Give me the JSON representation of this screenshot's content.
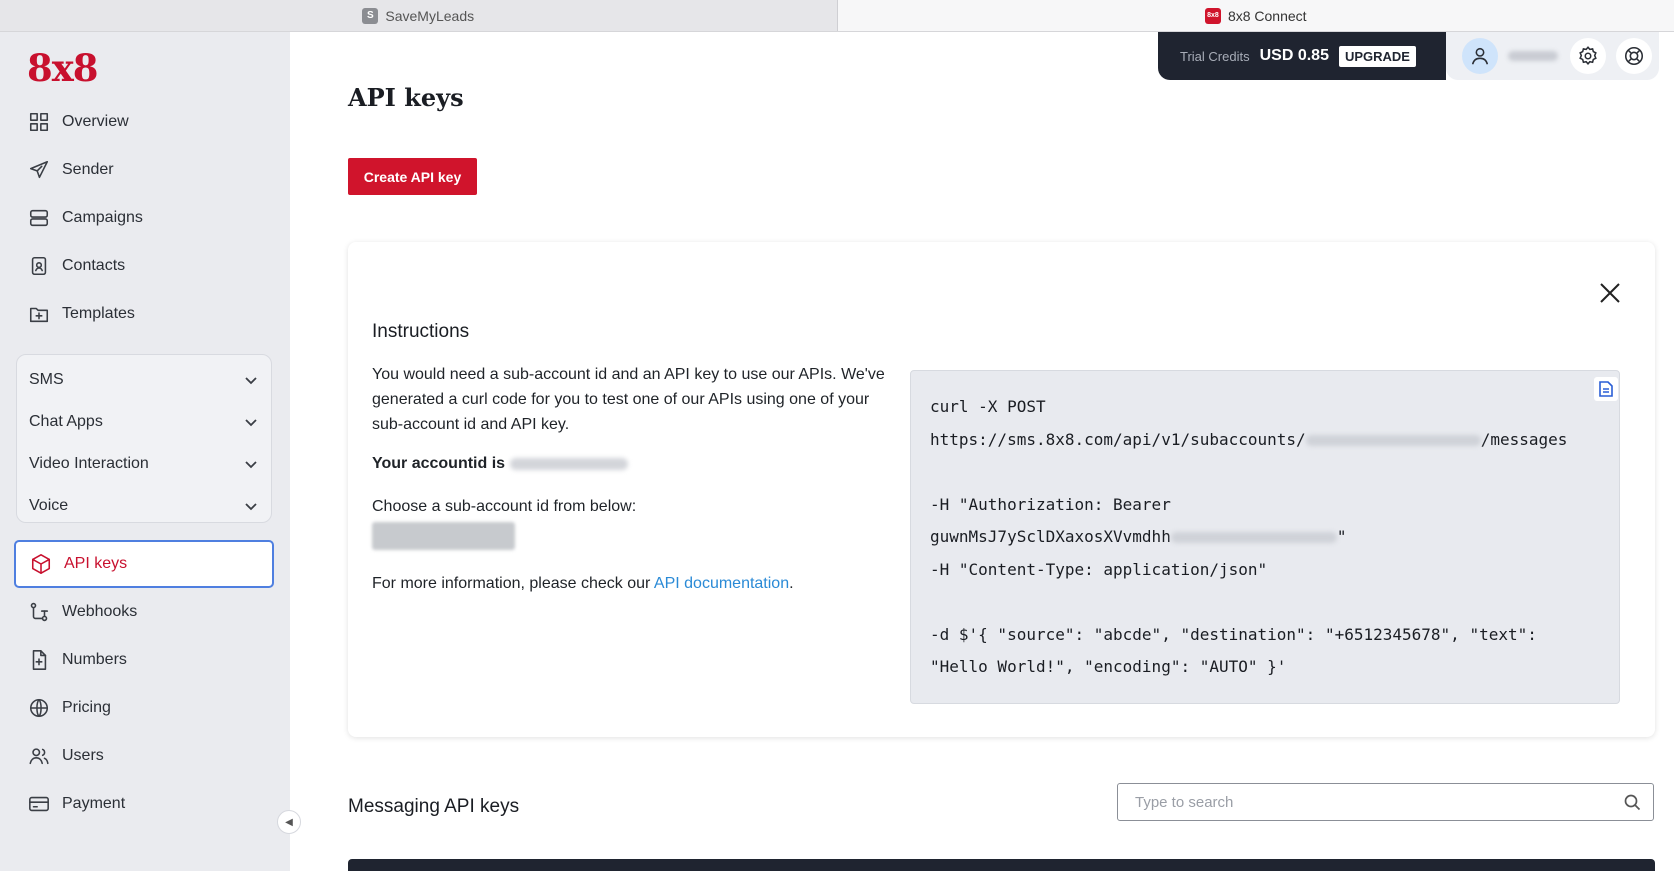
{
  "browser_tabs": [
    {
      "favicon": "S",
      "label": "SaveMyLeads"
    },
    {
      "favicon": "8x8",
      "label": "8x8 Connect"
    }
  ],
  "sidebar": {
    "logo": "8x8",
    "top_items": [
      {
        "label": "Overview",
        "icon": "grid-icon"
      },
      {
        "label": "Sender",
        "icon": "send-icon"
      },
      {
        "label": "Campaigns",
        "icon": "layers-icon"
      },
      {
        "label": "Contacts",
        "icon": "contact-card-icon"
      },
      {
        "label": "Templates",
        "icon": "folder-plus-icon"
      }
    ],
    "groups": [
      {
        "label": "SMS"
      },
      {
        "label": "Chat Apps"
      },
      {
        "label": "Video Interaction"
      },
      {
        "label": "Voice"
      }
    ],
    "bottom_items": [
      {
        "label": "API keys",
        "icon": "cube-icon",
        "active": true
      },
      {
        "label": "Webhooks",
        "icon": "webhook-icon"
      },
      {
        "label": "Numbers",
        "icon": "file-plus-icon"
      },
      {
        "label": "Pricing",
        "icon": "globe-icon"
      },
      {
        "label": "Users",
        "icon": "users-icon"
      },
      {
        "label": "Payment",
        "icon": "credit-card-icon"
      }
    ]
  },
  "topbar": {
    "credits_label": "Trial Credits",
    "credits_value": "USD 0.85",
    "upgrade_label": "UPGRADE"
  },
  "main": {
    "title": "API keys",
    "create_button": "Create API key",
    "instructions": {
      "title": "Instructions",
      "text": "You would need a sub-account id and an API key to use our APIs. We've generated a curl code for you to test one of our APIs using one of your sub-account id and API key.",
      "accountid_label": "Your accountid is",
      "choose_label": "Choose a sub-account id from below:",
      "more_info_prefix": "For more information, please check our ",
      "more_info_link": "API documentation",
      "more_info_suffix": "."
    },
    "code": {
      "line1": "curl -X POST",
      "line2_prefix": "https://sms.8x8.com/api/v1/subaccounts/",
      "line2_suffix": "/messages",
      "line3": "",
      "line4": "-H \"Authorization: Bearer",
      "line5_prefix": "guwnMsJ7ySclDXaxosXVvmdhh",
      "line5_suffix": "\"",
      "line6": "-H \"Content-Type: application/json\"",
      "line7": "",
      "line8": "-d $'{ \"source\": \"abcde\", \"destination\": \"+6512345678\", \"text\":",
      "line9": "\"Hello World!\", \"encoding\": \"AUTO\" }'"
    },
    "messaging": {
      "title": "Messaging API keys",
      "search_placeholder": "Type to search"
    }
  }
}
